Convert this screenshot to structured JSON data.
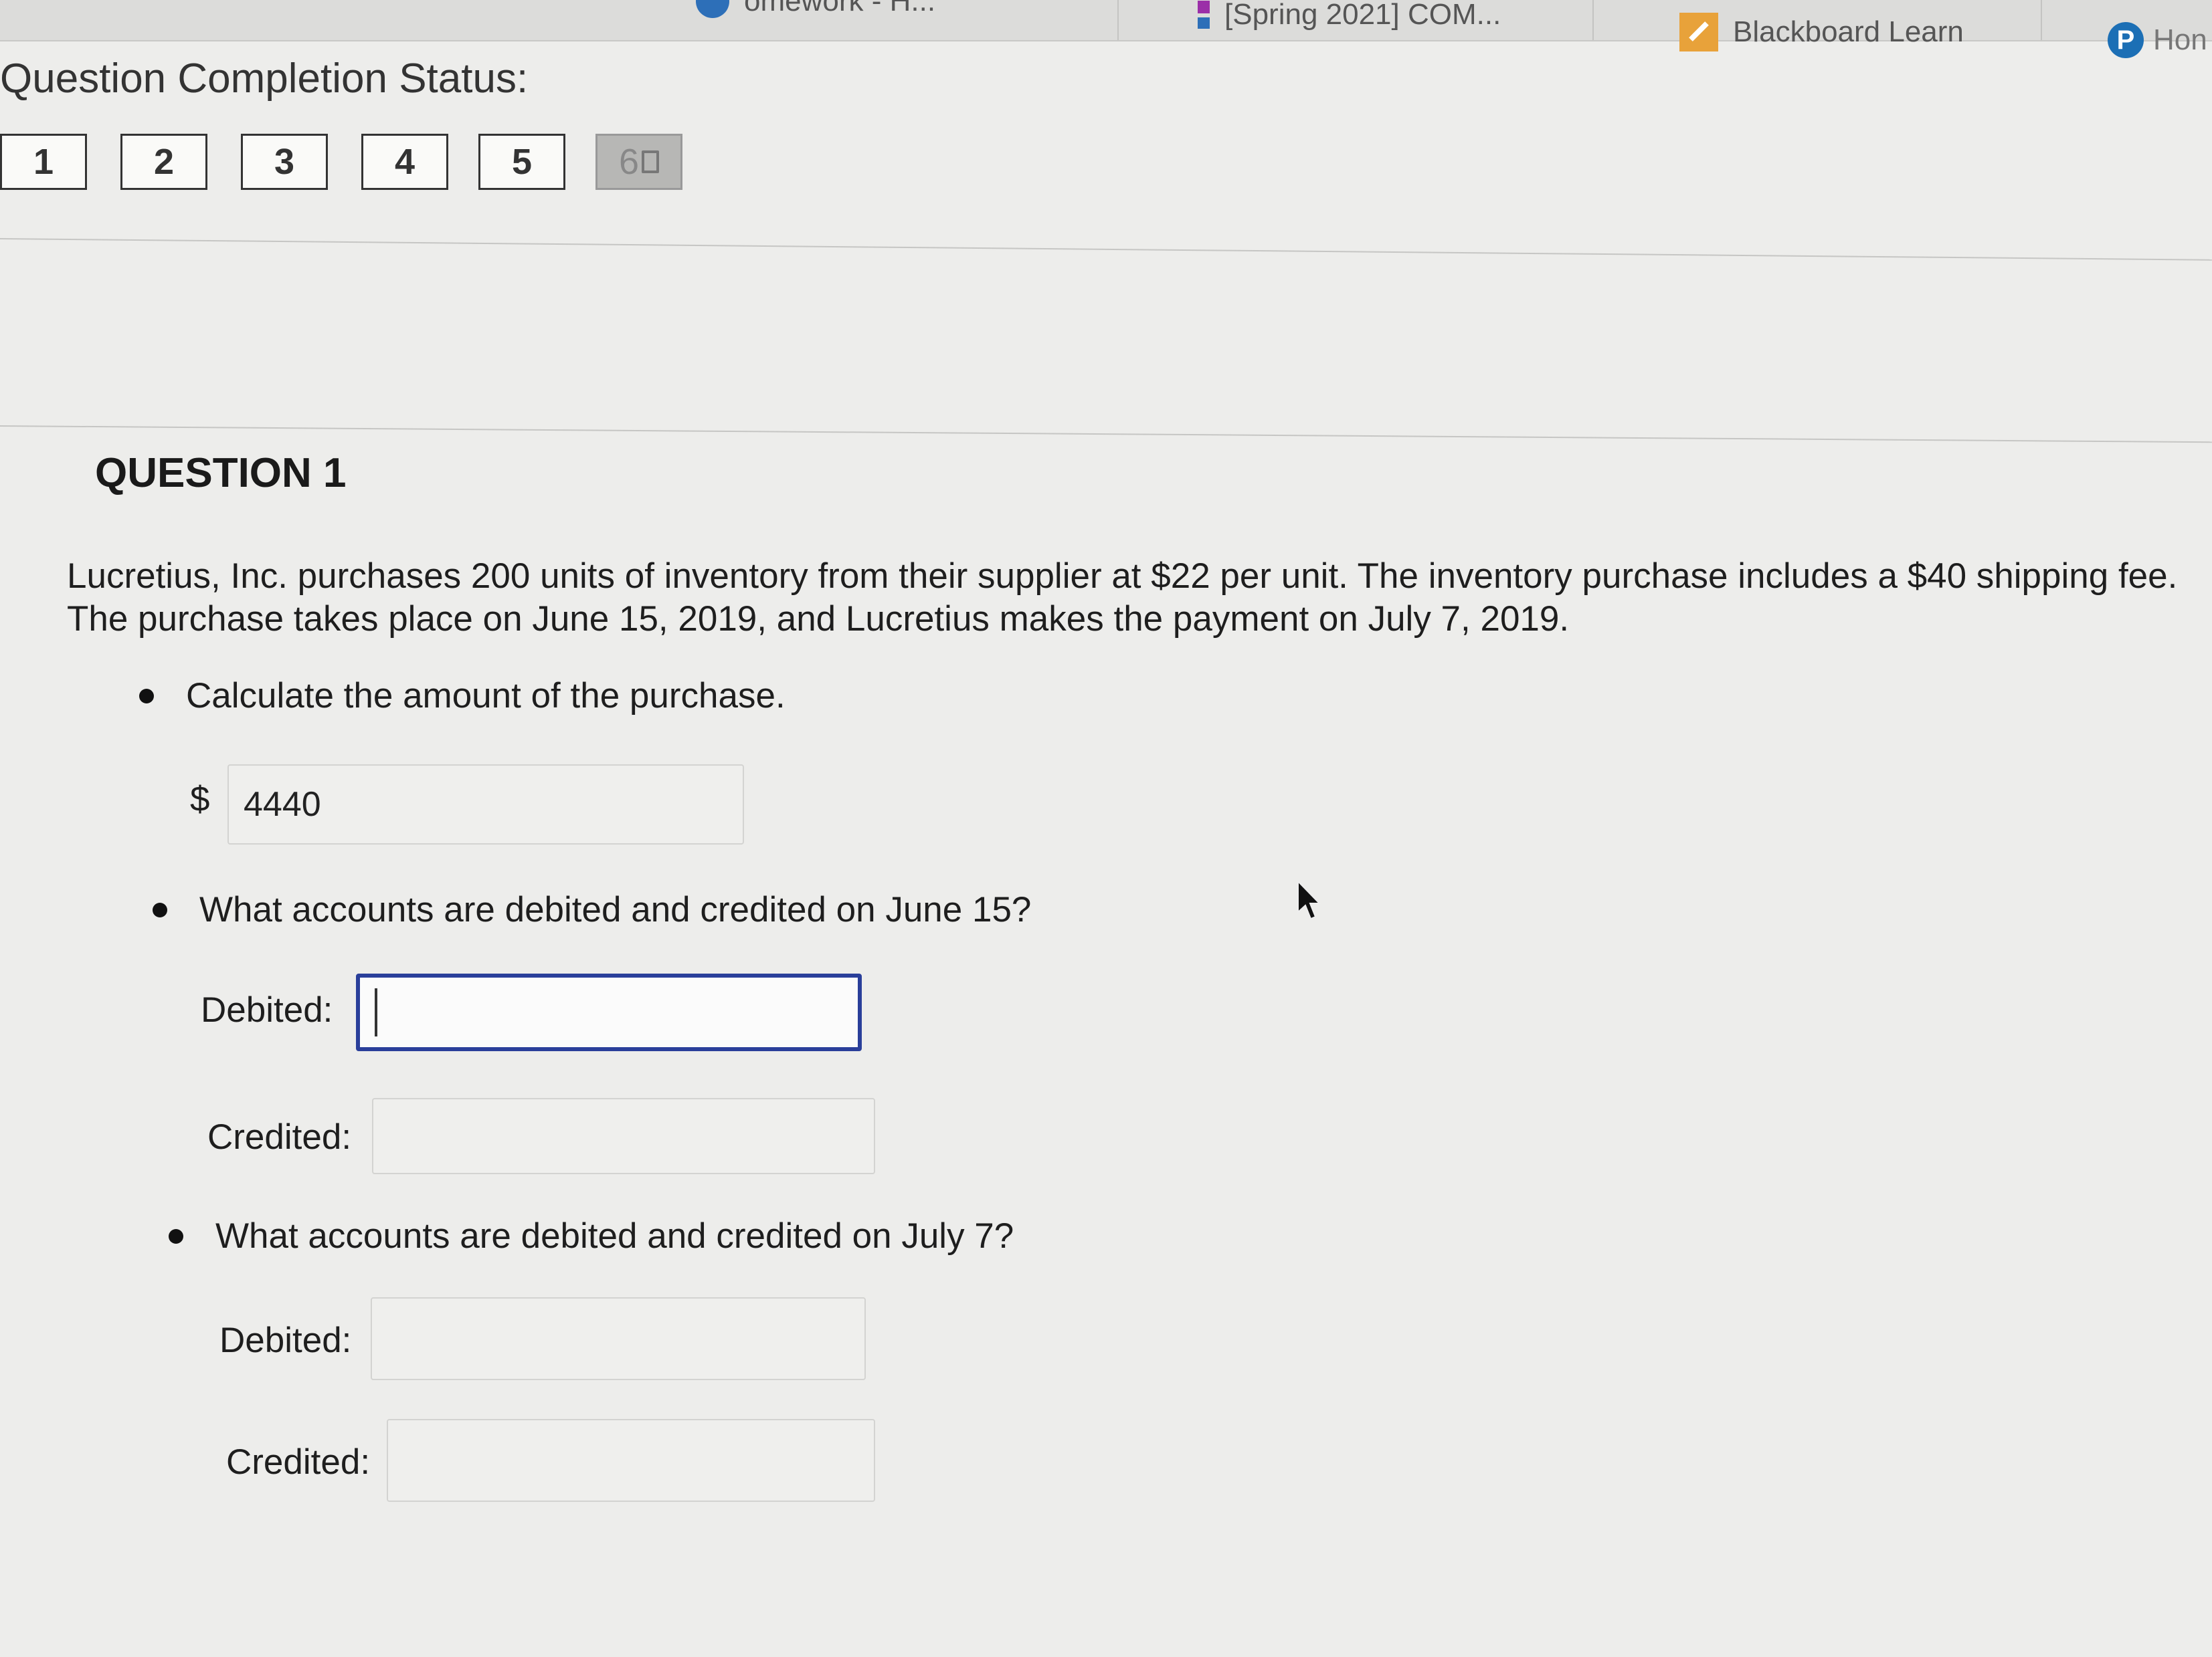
{
  "browser": {
    "bookmarks": [
      {
        "label": "omework - H..."
      },
      {
        "label": "[Spring 2021] COM..."
      },
      {
        "label": "Blackboard Learn"
      },
      {
        "label": "Hon"
      }
    ]
  },
  "completion": {
    "label": "Question Completion Status:",
    "questions": [
      "1",
      "2",
      "3",
      "4",
      "5",
      "6"
    ],
    "current": "6"
  },
  "question": {
    "title": "QUESTION 1",
    "text": "Lucretius, Inc. purchases 200 units of inventory from their supplier at $22 per unit. The inventory purchase includes a $40 shipping fee. The purchase takes place on June 15, 2019, and Lucretius makes the payment on July 7, 2019.",
    "parts": [
      {
        "prompt": "Calculate the amount of the purchase.",
        "currency": "$",
        "answer": "4440"
      },
      {
        "prompt": "What accounts are debited and credited on June 15?",
        "debited_label": "Debited:",
        "debited_value": "",
        "credited_label": "Credited:",
        "credited_value": ""
      },
      {
        "prompt": "What accounts are debited and credited on July 7?",
        "debited_label": "Debited:",
        "debited_value": "",
        "credited_label": "Credited:",
        "credited_value": ""
      }
    ]
  },
  "colors": {
    "focus_border": "#2a3f9a",
    "page_background": "#ededeb"
  }
}
